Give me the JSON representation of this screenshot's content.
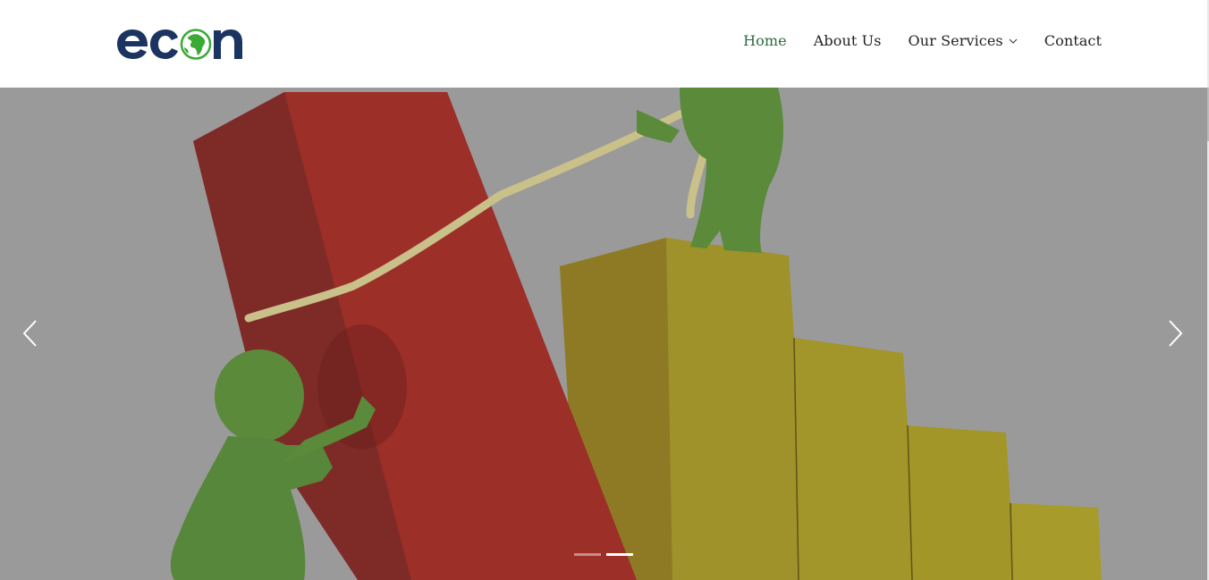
{
  "brand": {
    "logo_text": "econ",
    "logo_colors": {
      "text": "#1c3461",
      "globe": "#3aaa35"
    }
  },
  "nav": {
    "items": [
      {
        "label": "Home",
        "active": true
      },
      {
        "label": "About Us",
        "active": false
      },
      {
        "label": "Our Services",
        "active": false,
        "has_dropdown": true
      },
      {
        "label": "Contact",
        "active": false
      }
    ]
  },
  "carousel": {
    "prev_icon": "chevron-left-icon",
    "next_icon": "chevron-right-icon",
    "slide_count": 2,
    "active_slide": 2,
    "image_description_colors": {
      "overlay": "#9a9a9a",
      "red_bar": "#9b2f27",
      "yellow_bar": "#a79b2c",
      "figure": "#5a8a3a"
    }
  },
  "colors": {
    "accent": "#2e6b3a",
    "nav_text": "#222222",
    "white": "#ffffff"
  }
}
